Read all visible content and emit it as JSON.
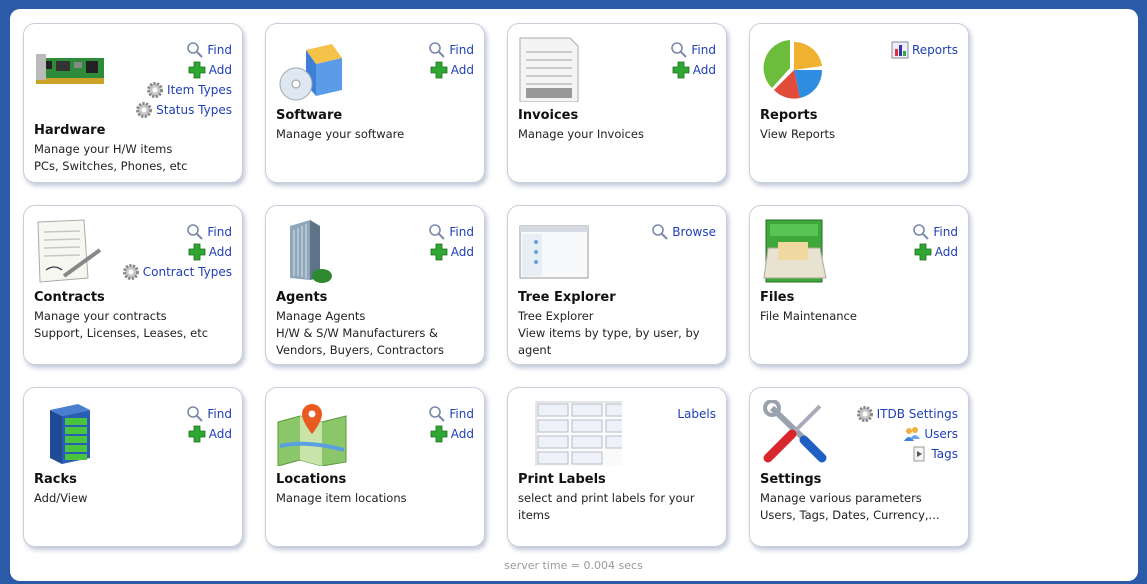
{
  "colors": {
    "link": "#1f3fb5",
    "background": "#2a5aa8"
  },
  "cards": {
    "hardware": {
      "title": "Hardware",
      "desc1": "Manage your H/W items",
      "desc2": "PCs, Switches, Phones, etc",
      "links": [
        "Find",
        "Add",
        "Item Types",
        "Status Types"
      ]
    },
    "software": {
      "title": "Software",
      "desc1": "Manage your software",
      "links": [
        "Find",
        "Add"
      ]
    },
    "invoices": {
      "title": "Invoices",
      "desc1": "Manage your Invoices",
      "links": [
        "Find",
        "Add"
      ]
    },
    "reports": {
      "title": "Reports",
      "desc1": "View Reports",
      "links": [
        "Reports"
      ]
    },
    "contracts": {
      "title": "Contracts",
      "desc1": "Manage your contracts",
      "desc2": "Support, Licenses, Leases, etc",
      "links": [
        "Find",
        "Add",
        "Contract Types"
      ]
    },
    "agents": {
      "title": "Agents",
      "desc1": "Manage Agents",
      "desc2": "H/W & S/W Manufacturers &",
      "desc3": "Vendors, Buyers, Contractors",
      "links": [
        "Find",
        "Add"
      ]
    },
    "tree": {
      "title": "Tree Explorer",
      "desc1": "Tree Explorer",
      "desc2": "View items by type, by user, by",
      "desc3": "agent",
      "links": [
        "Browse"
      ]
    },
    "files": {
      "title": "Files",
      "desc1": "File Maintenance",
      "links": [
        "Find",
        "Add"
      ]
    },
    "racks": {
      "title": "Racks",
      "desc1": "Add/View",
      "links": [
        "Find",
        "Add"
      ]
    },
    "locations": {
      "title": "Locations",
      "desc1": "Manage item locations",
      "links": [
        "Find",
        "Add"
      ]
    },
    "labels": {
      "title": "Print Labels",
      "desc1": "select and print labels for your items",
      "links": [
        "Labels"
      ]
    },
    "settings": {
      "title": "Settings",
      "desc1": "Manage various parameters",
      "desc2": "Users, Tags, Dates, Currency,...",
      "links": [
        "ITDB Settings",
        "Users",
        "Tags"
      ]
    }
  },
  "footer": "server time = 0.004 secs"
}
